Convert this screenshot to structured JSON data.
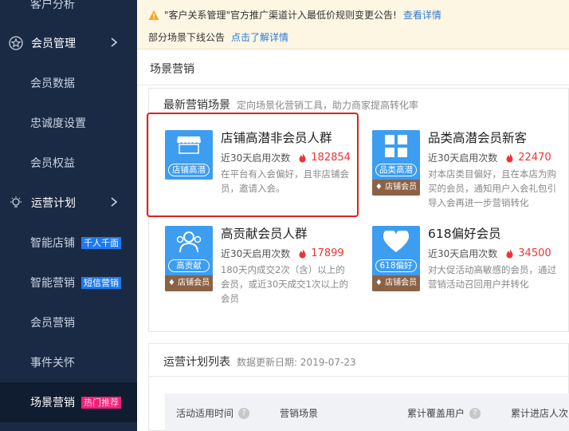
{
  "sidebar": {
    "items": [
      {
        "label": "客户分析"
      },
      {
        "label": "会员管理"
      },
      {
        "label": "会员数据"
      },
      {
        "label": "忠诚度设置"
      },
      {
        "label": "会员权益"
      },
      {
        "label": "运营计划"
      },
      {
        "label": "智能店铺",
        "badge": "千人千面"
      },
      {
        "label": "智能营销",
        "badge": "短信营销"
      },
      {
        "label": "会员营销"
      },
      {
        "label": "事件关怀"
      },
      {
        "label": "场景营销",
        "badge": "热门推荐"
      }
    ]
  },
  "notice": {
    "line1_text": "\"客户关系管理\"官方推广渠道计入最低价规则变更公告!",
    "line1_link": "查看详情",
    "line2_text": "部分场景下线公告",
    "line2_link": "点击了解详情"
  },
  "page": {
    "title": "场景营销"
  },
  "scenes_section": {
    "title": "最新营销场景",
    "desc": "定向场景化营销工具，助力商家提高转化率",
    "items": [
      {
        "name": "店铺高潜非会员人群",
        "img_label": "店铺高潜",
        "stat_label": "近30天启用次数",
        "stat_value": "182854",
        "desc": "在平台有入会偏好，且非店铺会员，邀请入会。"
      },
      {
        "name": "品类高潜会员新客",
        "img_label": "品类高潜",
        "tag": "店铺会员",
        "stat_label": "近30天启用次数",
        "stat_value": "22470",
        "desc": "对本店类目偏好，且在本店为购买的会员，通知用户入会礼包引导入会再进一步营销转化"
      },
      {
        "name": "高贡献会员人群",
        "img_label": "高贡献",
        "tag": "店铺会员",
        "stat_label": "近30天启用次数",
        "stat_value": "17899",
        "desc": "180天内成交2次（含）以上的会员，或近30天成交1次以上的会员"
      },
      {
        "name": "618偏好会员",
        "img_label": "618偏好",
        "tag": "店铺会员",
        "stat_label": "近30天启用次数",
        "stat_value": "34500",
        "desc": "对大促活动高敏感的会员，通过营销活动召回用户并转化"
      }
    ]
  },
  "plan_section": {
    "title": "运营计划列表",
    "date_label": "数据更新日期: 2019-07-23",
    "columns": [
      "活动适用时间",
      "营销场景",
      "累计覆盖用户",
      "累计进店人次"
    ]
  },
  "colors": {
    "sidebar_bg": "#1b2a44",
    "accent_blue": "#3d9df0",
    "stat_red": "#e33",
    "highlight_red": "#e02020"
  }
}
